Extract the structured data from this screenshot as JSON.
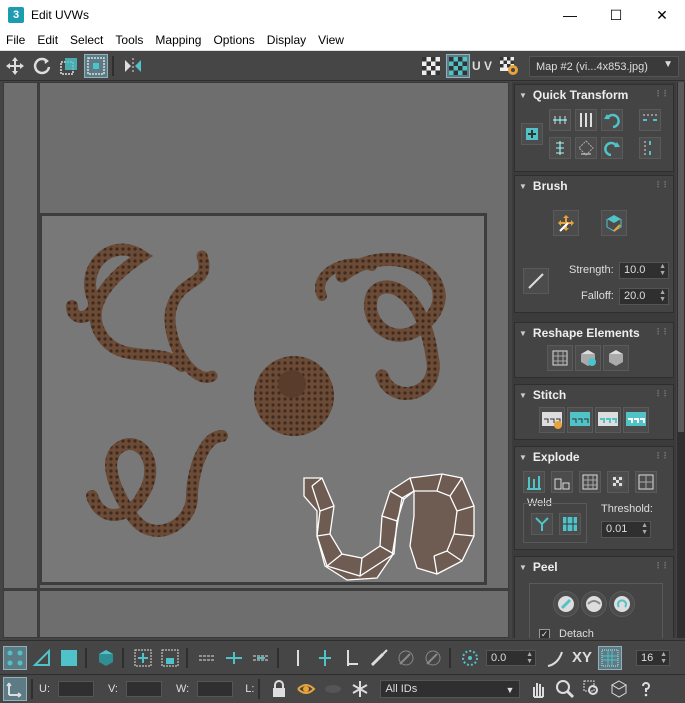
{
  "window": {
    "icon_label": "3",
    "title": "Edit UVWs",
    "minimize": "—",
    "maximize": "☐",
    "close": "✕"
  },
  "menu": [
    "File",
    "Edit",
    "Select",
    "Tools",
    "Mapping",
    "Options",
    "Display",
    "View"
  ],
  "toolbar": {
    "uv_label": "U V",
    "map_dropdown": "Map #2 (vi...4x853.jpg)"
  },
  "panel": {
    "quick_transform": {
      "title": "Quick Transform"
    },
    "brush": {
      "title": "Brush",
      "strength_label": "Strength:",
      "strength_value": "10.0",
      "falloff_label": "Falloff:",
      "falloff_value": "20.0"
    },
    "reshape": {
      "title": "Reshape Elements"
    },
    "stitch": {
      "title": "Stitch"
    },
    "explode": {
      "title": "Explode",
      "weld_label": "Weld",
      "threshold_label": "Threshold:",
      "threshold_value": "0.01"
    },
    "peel": {
      "title": "Peel",
      "detach_label": "Detach",
      "detach_checked": true
    }
  },
  "bottom1": {
    "angle_value": "0.0",
    "xy_label": "XY",
    "grid_value": "16"
  },
  "bottom2": {
    "u_label": "U:",
    "v_label": "V:",
    "w_label": "W:",
    "l_label": "L:",
    "u_value": "",
    "v_value": "",
    "w_value": "",
    "l_value": "",
    "ids_dropdown": "All IDs"
  },
  "colors": {
    "accent": "#4fc3c8",
    "viewport_bg": "#6e6e6e",
    "panel_bg": "#444444",
    "wire": "#ffffff"
  }
}
